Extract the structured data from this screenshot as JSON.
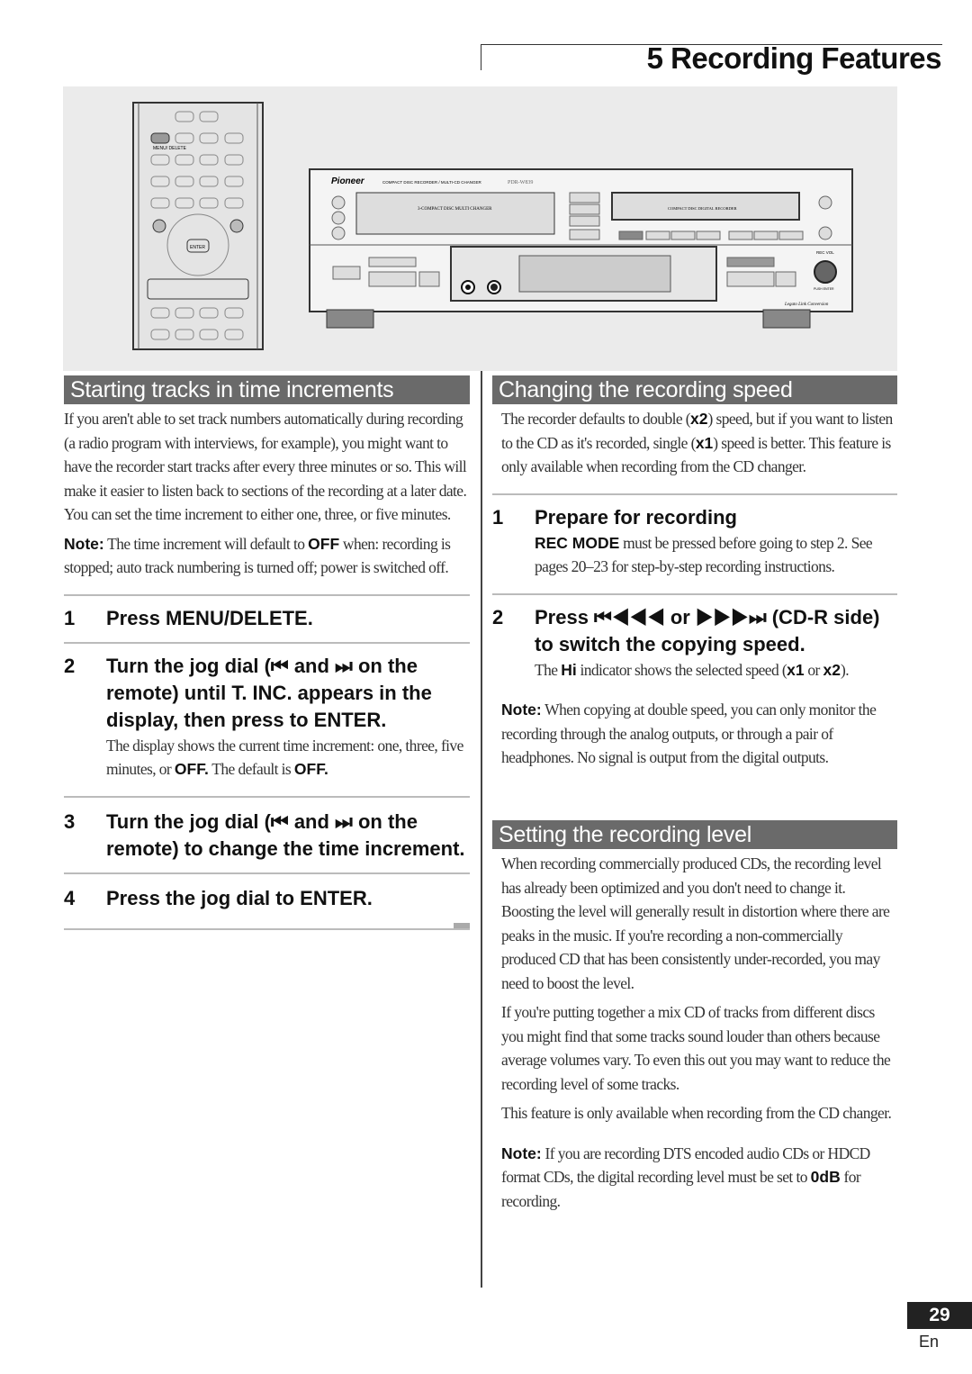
{
  "header": {
    "chapter_title": "5 Recording Features"
  },
  "figure": {
    "remote": {
      "menu_label": "MENU/ DELETE",
      "enter_label": "ENTER",
      "prev_symbol": "⏮",
      "next_symbol": "⏭"
    },
    "device": {
      "brand": "Pioneer",
      "subtitle": "COMPACT DISC RECORDER / MULTI-CD CHANGER",
      "model": "PDR-W839",
      "changer_label": "3-COMPACT DISC MULTI CHANGER",
      "recorder_label": "COMPACT DISC DIGITAL RECORDER",
      "rec_vol": "REC VOL",
      "push_enter": "PUSH ENTER",
      "legato": "Legato Link Conversion"
    }
  },
  "left": {
    "heading": "Starting tracks in time increments",
    "intro": "If you aren't able to set track numbers automatically during recording (a radio program with interviews, for example), you might want to have the recorder start tracks after every three minutes or so. This will make it easier to listen back to sections of the recording at a later date. You can set the time increment to either one, three, or five minutes.",
    "note_label": "Note:",
    "note_a": " The time increment will default to ",
    "note_off": "OFF",
    "note_b": " when: recording is stopped; auto track numbering is turned off; power is switched off.",
    "steps": [
      {
        "num": "1",
        "text": "Press MENU/DELETE."
      },
      {
        "num": "2",
        "text": "Turn the jog dial (⏮ and ⏭ on the remote) until T. INC. appears in the display, then press to ENTER.",
        "desc_a": "The display shows the current time increment: one, three, five minutes, or ",
        "desc_off1": "OFF.",
        "desc_b": " The default is ",
        "desc_off2": "OFF."
      },
      {
        "num": "3",
        "text": "Turn the jog dial (⏮ and ⏭ on the remote) to change the time increment."
      },
      {
        "num": "4",
        "text": "Press the jog dial to ENTER."
      }
    ]
  },
  "right": {
    "speed": {
      "heading": "Changing the recording speed",
      "intro_a": "The recorder defaults to double (",
      "x2": "x2",
      "intro_b": ") speed, but if you want to listen to the CD as it's recorded, single (",
      "x1": "x1",
      "intro_c": ") speed is better. This feature is only available when recording from the CD changer.",
      "steps": [
        {
          "num": "1",
          "text": "Prepare for recording",
          "desc_key": "REC MODE",
          "desc": " must be pressed before going to step 2. See pages 20–23 for step-by-step recording instructions."
        },
        {
          "num": "2",
          "text": "Press ⏮◀◀◀ or ▶▶▶⏭ (CD-R side) to switch the copying speed.",
          "desc_a": "The ",
          "hi": "Hi",
          "desc_b": " indicator shows the selected speed (",
          "x1": "x1",
          "desc_c": "  or ",
          "x2": "x2",
          "desc_d": ")."
        }
      ],
      "note_label": "Note:",
      "note": " When copying at double speed, you can only monitor the recording through the analog outputs, or through a pair of headphones. No signal is output from the digital outputs."
    },
    "level": {
      "heading": "Setting the recording level",
      "p1": "When recording commercially produced CDs, the recording level has already been optimized and you don't need to change it. Boosting the level will generally result in distortion where there are peaks in the music. If you're recording a non-commercially produced CD that has been consistently under-recorded, you may need to boost the level.",
      "p2": "If you're putting together a mix CD of tracks from different discs you might find that some tracks sound louder than others because  average volumes vary. To even this out you may want to reduce the recording level of some tracks.",
      "p3": "This feature is only available when recording from the CD changer.",
      "note_label": "Note:",
      "note_a": " If you are recording DTS encoded audio CDs or HDCD format CDs, the digital recording level must be set to ",
      "odb": "0dB",
      "note_b": " for recording."
    }
  },
  "footer": {
    "page_number": "29",
    "language": "En"
  }
}
